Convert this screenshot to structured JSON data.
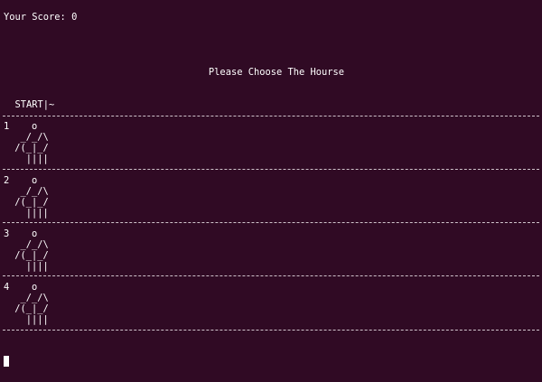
{
  "score": {
    "label": "Your Score: 0"
  },
  "prompt": {
    "text": "Please Choose The Hourse"
  },
  "track": {
    "start_label": "  START|~"
  },
  "lanes": [
    {
      "number": "1",
      "art": "    o\n  _/_/\\\n /(_|_/\n   ||||"
    },
    {
      "number": "2",
      "art": "    o\n  _/_/\\\n /(_|_/\n   ||||"
    },
    {
      "number": "3",
      "art": "    o\n  _/_/\\\n /(_|_/\n   ||||"
    },
    {
      "number": "4",
      "art": "    o\n  _/_/\\\n /(_|_/\n   ||||"
    }
  ],
  "colors": {
    "background": "#300a24",
    "foreground": "#ffffff",
    "divider": "#cfc3cb"
  }
}
